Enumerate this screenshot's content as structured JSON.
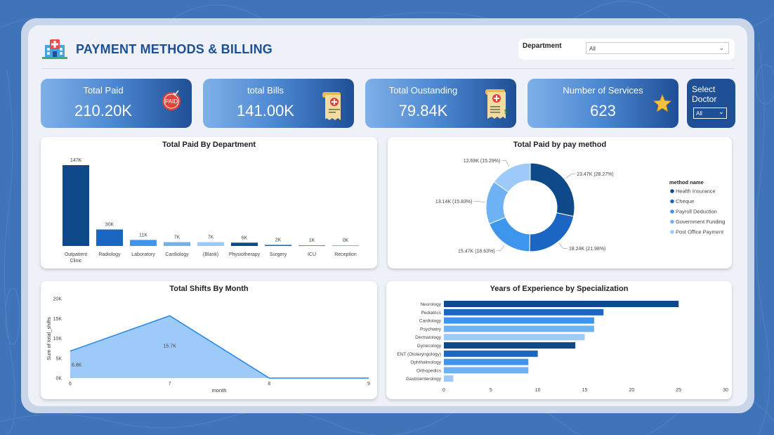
{
  "header": {
    "title": "PAYMENT METHODS & BILLING"
  },
  "filters": {
    "department": {
      "label": "Department",
      "value": "All"
    },
    "doctor": {
      "label_line1": "Select",
      "label_line2": "Doctor",
      "value": "All"
    }
  },
  "kpis": [
    {
      "label": "Total Paid",
      "value": "210.20K",
      "icon": "paid-stamp-icon"
    },
    {
      "label": "total Bills",
      "value": "141.00K",
      "icon": "medical-bill-icon"
    },
    {
      "label": "Total Oustanding",
      "value": "79.84K",
      "icon": "invoice-icon"
    },
    {
      "label": "Number of Services",
      "value": "623",
      "icon": "star-icon"
    }
  ],
  "icons": {
    "paid_stamp_text": "PAID"
  },
  "colors": {
    "dark_blue": "#0e4a8a",
    "mid_blue": "#1a66c2",
    "bright_blue": "#3d96ec",
    "light_blue": "#6eb2f4",
    "pale_blue": "#9dcaf8",
    "title_blue": "#1c4f96"
  },
  "chart_data": [
    {
      "type": "bar",
      "title": "Total Paid By Department",
      "categories": [
        "Outpatient Clinic",
        "Radiology",
        "Laboratory",
        "Cardiology",
        "(Blank)",
        "Physiotherapy",
        "Surgery",
        "ICU",
        "Reception"
      ],
      "values": [
        147,
        30,
        11,
        7,
        7,
        6,
        2,
        1,
        0
      ],
      "data_labels": [
        "147K",
        "30K",
        "11K",
        "7K",
        "7K",
        "6K",
        "2K",
        "1K",
        "0K"
      ],
      "bar_colors": [
        "#0e4a8a",
        "#1a66c2",
        "#3d96ec",
        "#6eb2f4",
        "#9dcaf8",
        "#0e4a8a",
        "#1a66c2",
        "#3d96ec",
        "#6eb2f4"
      ]
    },
    {
      "type": "pie",
      "title": "Total Paid by pay method",
      "legend_title": "method name",
      "legend_position": "right",
      "slices": [
        {
          "name": "Health Insurance",
          "value": 23.47,
          "label": "23.47K (28.27%)",
          "color": "#0e4a8a"
        },
        {
          "name": "Cheque",
          "value": 18.24,
          "label": "18.24K (21.98%)",
          "color": "#1a66c2"
        },
        {
          "name": "Payroll Deduction",
          "value": 15.47,
          "label": "15.47K (18.63%)",
          "color": "#3d96ec"
        },
        {
          "name": "Government Funding",
          "value": 13.14,
          "label": "13.14K (15.83%)",
          "color": "#6eb2f4"
        },
        {
          "name": "Post Office Payment",
          "value": 12.69,
          "label": "12.69K (15.29%)",
          "color": "#9dcaf8"
        }
      ]
    },
    {
      "type": "area",
      "title": "Total Shifts By Month",
      "xlabel": "month",
      "ylabel": "Sum of total_shifts",
      "x": [
        6,
        7,
        8,
        9
      ],
      "y": [
        6800,
        15700,
        0,
        0
      ],
      "data_labels": [
        "6.8K",
        "15.7K"
      ],
      "ylim": [
        0,
        20000
      ],
      "y_ticks": [
        "0K",
        "5K",
        "10K",
        "15K",
        "20K"
      ],
      "x_ticks": [
        "6",
        "7",
        "8",
        "9"
      ]
    },
    {
      "type": "bar",
      "orientation": "horizontal",
      "title": "Years of Experience by Specialization",
      "categories": [
        "Neurology",
        "Pediatrics",
        "Cardiology",
        "Psychiatry",
        "Dermatology",
        "Gynecology",
        "ENT (Otolaryngology)",
        "Ophthalmology",
        "Orthopedics",
        "Gastroenterology"
      ],
      "values": [
        25,
        17,
        16,
        16,
        15,
        14,
        10,
        9,
        9,
        1
      ],
      "xlim": [
        0,
        30
      ],
      "x_ticks": [
        "0",
        "5",
        "10",
        "15",
        "20",
        "25",
        "30"
      ],
      "bar_colors": [
        "#0e4a8a",
        "#1a66c2",
        "#3d96ec",
        "#6eb2f4",
        "#9dcaf8",
        "#0e4a8a",
        "#1a66c2",
        "#3d96ec",
        "#6eb2f4",
        "#9dcaf8"
      ]
    }
  ]
}
